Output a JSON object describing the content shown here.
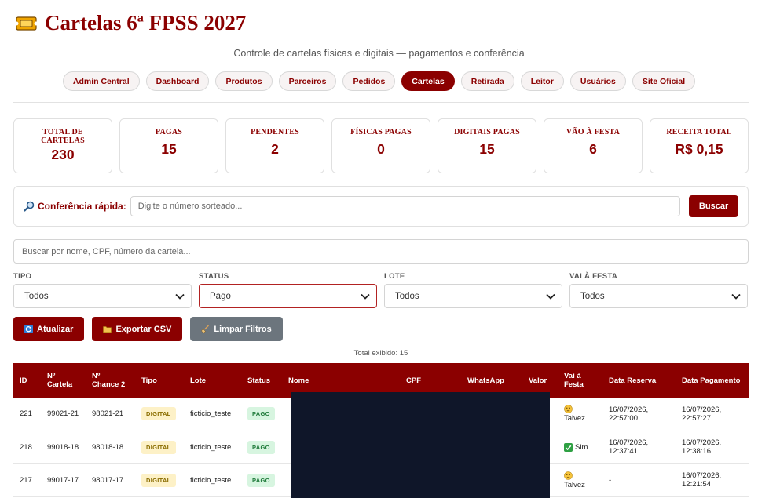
{
  "header": {
    "title": "Cartelas 6ª FPSS 2027",
    "subtitle": "Controle de cartelas físicas e digitais — pagamentos e conferência",
    "icon": "ticket-icon",
    "accent": "#8b0000"
  },
  "nav": [
    {
      "label": "Admin Central",
      "active": false
    },
    {
      "label": "Dashboard",
      "active": false
    },
    {
      "label": "Produtos",
      "active": false
    },
    {
      "label": "Parceiros",
      "active": false
    },
    {
      "label": "Pedidos",
      "active": false
    },
    {
      "label": "Cartelas",
      "active": true
    },
    {
      "label": "Retirada",
      "active": false
    },
    {
      "label": "Leitor",
      "active": false
    },
    {
      "label": "Usuários",
      "active": false
    },
    {
      "label": "Site Oficial",
      "active": false
    }
  ],
  "stats": [
    {
      "label": "TOTAL DE CARTELAS",
      "value": "230"
    },
    {
      "label": "PAGAS",
      "value": "15"
    },
    {
      "label": "PENDENTES",
      "value": "2"
    },
    {
      "label": "FÍSICAS PAGAS",
      "value": "0"
    },
    {
      "label": "DIGITAIS PAGAS",
      "value": "15"
    },
    {
      "label": "VÃO À FESTA",
      "value": "6"
    },
    {
      "label": "RECEITA TOTAL",
      "value": "R$ 0,15"
    }
  ],
  "quick": {
    "label": "Conferência rápida:",
    "placeholder": "Digite o número sorteado...",
    "button": "Buscar"
  },
  "search": {
    "placeholder": "Buscar por nome, CPF, número da cartela..."
  },
  "filters": [
    {
      "label": "TIPO",
      "value": "Todos"
    },
    {
      "label": "STATUS",
      "value": "Pago"
    },
    {
      "label": "LOTE",
      "value": "Todos"
    },
    {
      "label": "VAI À FESTA",
      "value": "Todos"
    }
  ],
  "actions": {
    "refresh": "Atualizar",
    "export": "Exportar CSV",
    "clear": "Limpar Filtros"
  },
  "total_label": "Total exibido: 15",
  "table": {
    "headers": [
      "ID",
      "Nº Cartela",
      "Nº Chance 2",
      "Tipo",
      "Lote",
      "Status",
      "Nome",
      "CPF",
      "WhatsApp",
      "Valor",
      "Vai à Festa",
      "Data Reserva",
      "Data Pagamento"
    ],
    "rows": [
      {
        "id": "221",
        "cartela": "99021-21",
        "chance": "98021-21",
        "tipo": "DIGITAL",
        "lote": "ficticio_teste",
        "status": "PAGO",
        "vai": "Talvez",
        "vai_icon": "thinking-face-icon",
        "reserva": "16/07/2026, 22:57:00",
        "pagamento": "16/07/2026, 22:57:27"
      },
      {
        "id": "218",
        "cartela": "99018-18",
        "chance": "98018-18",
        "tipo": "DIGITAL",
        "lote": "ficticio_teste",
        "status": "PAGO",
        "vai": "Sim",
        "vai_icon": "check-box-icon",
        "reserva": "16/07/2026, 12:37:41",
        "pagamento": "16/07/2026, 12:38:16"
      },
      {
        "id": "217",
        "cartela": "99017-17",
        "chance": "98017-17",
        "tipo": "DIGITAL",
        "lote": "ficticio_teste",
        "status": "PAGO",
        "vai": "Talvez",
        "vai_icon": "thinking-face-icon",
        "reserva": "-",
        "pagamento": "16/07/2026, 12:21:54"
      }
    ]
  }
}
